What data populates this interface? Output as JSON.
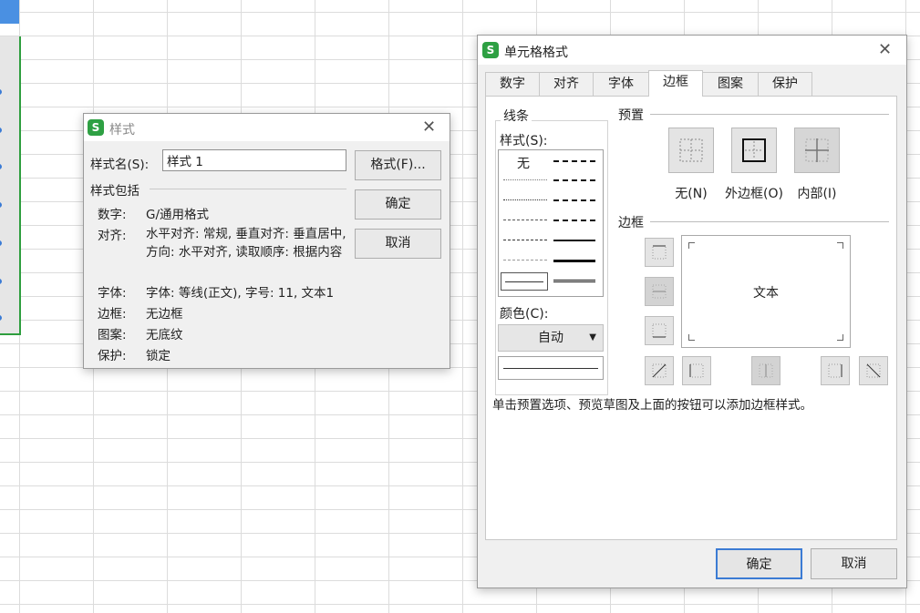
{
  "colors": {
    "accent_green": "#2ea043",
    "selection_blue": "#3a7bd5",
    "ok_border": "#3b7bd4"
  },
  "style_dialog": {
    "title": "样式",
    "name_label": "样式名(S):",
    "name_value": "样式 1",
    "includes_label": "样式包括",
    "rows": [
      {
        "label": "数字:",
        "value": "G/通用格式"
      },
      {
        "label": "对齐:",
        "value": "水平对齐: 常规, 垂直对齐: 垂直居中, 方向: 水平对齐, 读取顺序: 根据内容"
      },
      {
        "label": "字体:",
        "value": "字体: 等线(正文), 字号: 11, 文本1"
      },
      {
        "label": "边框:",
        "value": "无边框"
      },
      {
        "label": "图案:",
        "value": "无底纹"
      },
      {
        "label": "保护:",
        "value": "锁定"
      }
    ],
    "format_button": "格式(F)...",
    "ok_button": "确定",
    "cancel_button": "取消",
    "icon": "wps-s-icon"
  },
  "format_dialog": {
    "title": "单元格格式",
    "icon": "wps-s-icon",
    "tabs": [
      "数字",
      "对齐",
      "字体",
      "边框",
      "图案",
      "保护"
    ],
    "active_tab": "边框",
    "line_group_label": "线条",
    "style_label": "样式(S):",
    "style_none": "无",
    "color_label": "颜色(C):",
    "color_value": "自动",
    "preset_label": "预置",
    "presets": [
      "无(N)",
      "外边框(O)",
      "内部(I)"
    ],
    "border_label": "边框",
    "preview_text": "文本",
    "hint": "单击预置选项、预览草图及上面的按钮可以添加边框样式。",
    "ok_button": "确定",
    "cancel_button": "取消"
  }
}
